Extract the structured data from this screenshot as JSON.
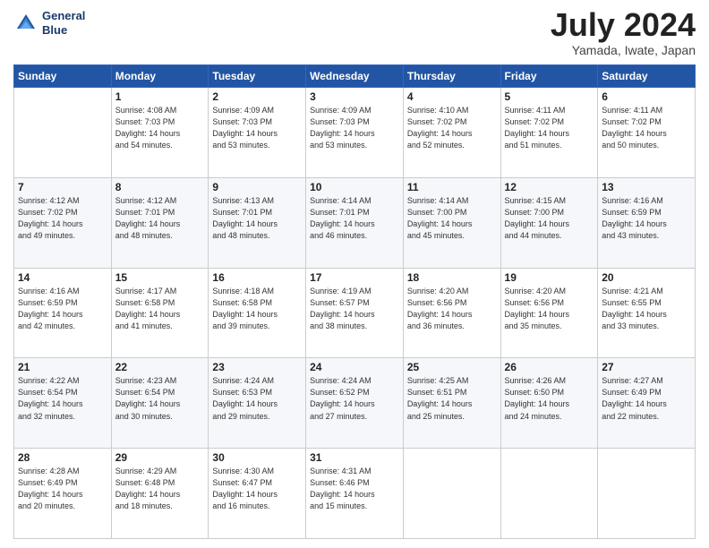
{
  "header": {
    "logo_line1": "General",
    "logo_line2": "Blue",
    "month": "July 2024",
    "location": "Yamada, Iwate, Japan"
  },
  "weekdays": [
    "Sunday",
    "Monday",
    "Tuesday",
    "Wednesday",
    "Thursday",
    "Friday",
    "Saturday"
  ],
  "weeks": [
    [
      {
        "day": "",
        "content": ""
      },
      {
        "day": "1",
        "content": "Sunrise: 4:08 AM\nSunset: 7:03 PM\nDaylight: 14 hours\nand 54 minutes."
      },
      {
        "day": "2",
        "content": "Sunrise: 4:09 AM\nSunset: 7:03 PM\nDaylight: 14 hours\nand 53 minutes."
      },
      {
        "day": "3",
        "content": "Sunrise: 4:09 AM\nSunset: 7:03 PM\nDaylight: 14 hours\nand 53 minutes."
      },
      {
        "day": "4",
        "content": "Sunrise: 4:10 AM\nSunset: 7:02 PM\nDaylight: 14 hours\nand 52 minutes."
      },
      {
        "day": "5",
        "content": "Sunrise: 4:11 AM\nSunset: 7:02 PM\nDaylight: 14 hours\nand 51 minutes."
      },
      {
        "day": "6",
        "content": "Sunrise: 4:11 AM\nSunset: 7:02 PM\nDaylight: 14 hours\nand 50 minutes."
      }
    ],
    [
      {
        "day": "7",
        "content": "Sunrise: 4:12 AM\nSunset: 7:02 PM\nDaylight: 14 hours\nand 49 minutes."
      },
      {
        "day": "8",
        "content": "Sunrise: 4:12 AM\nSunset: 7:01 PM\nDaylight: 14 hours\nand 48 minutes."
      },
      {
        "day": "9",
        "content": "Sunrise: 4:13 AM\nSunset: 7:01 PM\nDaylight: 14 hours\nand 48 minutes."
      },
      {
        "day": "10",
        "content": "Sunrise: 4:14 AM\nSunset: 7:01 PM\nDaylight: 14 hours\nand 46 minutes."
      },
      {
        "day": "11",
        "content": "Sunrise: 4:14 AM\nSunset: 7:00 PM\nDaylight: 14 hours\nand 45 minutes."
      },
      {
        "day": "12",
        "content": "Sunrise: 4:15 AM\nSunset: 7:00 PM\nDaylight: 14 hours\nand 44 minutes."
      },
      {
        "day": "13",
        "content": "Sunrise: 4:16 AM\nSunset: 6:59 PM\nDaylight: 14 hours\nand 43 minutes."
      }
    ],
    [
      {
        "day": "14",
        "content": "Sunrise: 4:16 AM\nSunset: 6:59 PM\nDaylight: 14 hours\nand 42 minutes."
      },
      {
        "day": "15",
        "content": "Sunrise: 4:17 AM\nSunset: 6:58 PM\nDaylight: 14 hours\nand 41 minutes."
      },
      {
        "day": "16",
        "content": "Sunrise: 4:18 AM\nSunset: 6:58 PM\nDaylight: 14 hours\nand 39 minutes."
      },
      {
        "day": "17",
        "content": "Sunrise: 4:19 AM\nSunset: 6:57 PM\nDaylight: 14 hours\nand 38 minutes."
      },
      {
        "day": "18",
        "content": "Sunrise: 4:20 AM\nSunset: 6:56 PM\nDaylight: 14 hours\nand 36 minutes."
      },
      {
        "day": "19",
        "content": "Sunrise: 4:20 AM\nSunset: 6:56 PM\nDaylight: 14 hours\nand 35 minutes."
      },
      {
        "day": "20",
        "content": "Sunrise: 4:21 AM\nSunset: 6:55 PM\nDaylight: 14 hours\nand 33 minutes."
      }
    ],
    [
      {
        "day": "21",
        "content": "Sunrise: 4:22 AM\nSunset: 6:54 PM\nDaylight: 14 hours\nand 32 minutes."
      },
      {
        "day": "22",
        "content": "Sunrise: 4:23 AM\nSunset: 6:54 PM\nDaylight: 14 hours\nand 30 minutes."
      },
      {
        "day": "23",
        "content": "Sunrise: 4:24 AM\nSunset: 6:53 PM\nDaylight: 14 hours\nand 29 minutes."
      },
      {
        "day": "24",
        "content": "Sunrise: 4:24 AM\nSunset: 6:52 PM\nDaylight: 14 hours\nand 27 minutes."
      },
      {
        "day": "25",
        "content": "Sunrise: 4:25 AM\nSunset: 6:51 PM\nDaylight: 14 hours\nand 25 minutes."
      },
      {
        "day": "26",
        "content": "Sunrise: 4:26 AM\nSunset: 6:50 PM\nDaylight: 14 hours\nand 24 minutes."
      },
      {
        "day": "27",
        "content": "Sunrise: 4:27 AM\nSunset: 6:49 PM\nDaylight: 14 hours\nand 22 minutes."
      }
    ],
    [
      {
        "day": "28",
        "content": "Sunrise: 4:28 AM\nSunset: 6:49 PM\nDaylight: 14 hours\nand 20 minutes."
      },
      {
        "day": "29",
        "content": "Sunrise: 4:29 AM\nSunset: 6:48 PM\nDaylight: 14 hours\nand 18 minutes."
      },
      {
        "day": "30",
        "content": "Sunrise: 4:30 AM\nSunset: 6:47 PM\nDaylight: 14 hours\nand 16 minutes."
      },
      {
        "day": "31",
        "content": "Sunrise: 4:31 AM\nSunset: 6:46 PM\nDaylight: 14 hours\nand 15 minutes."
      },
      {
        "day": "",
        "content": ""
      },
      {
        "day": "",
        "content": ""
      },
      {
        "day": "",
        "content": ""
      }
    ]
  ]
}
